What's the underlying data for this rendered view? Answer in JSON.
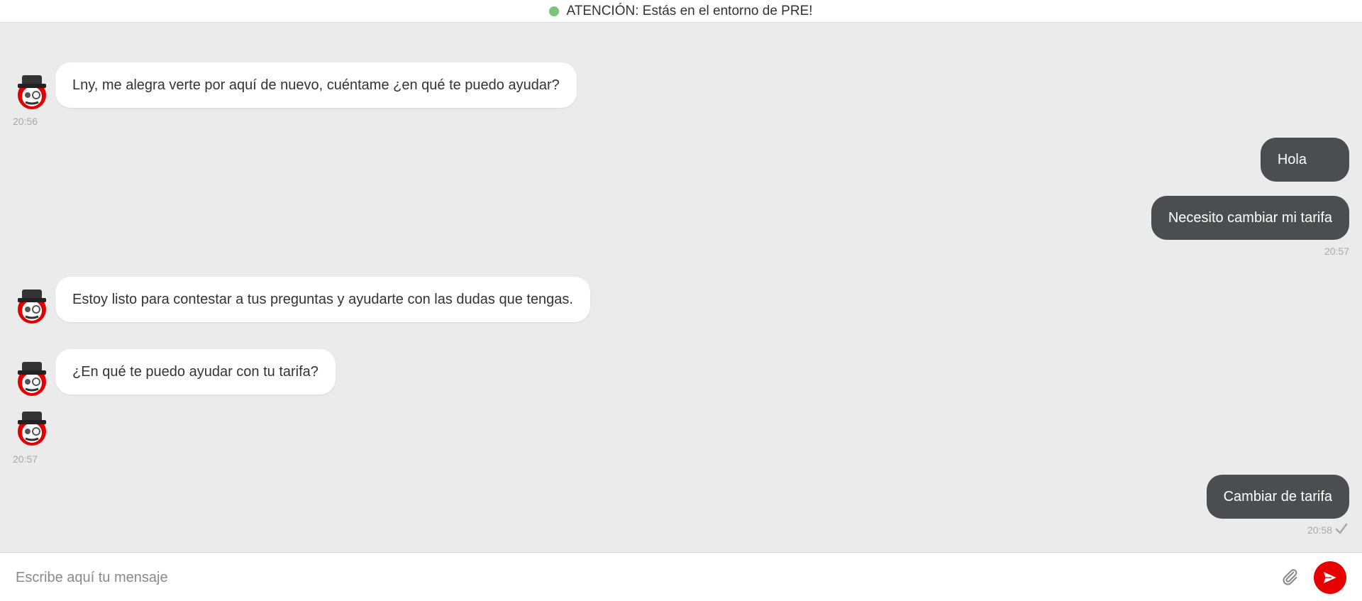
{
  "banner": {
    "text": "ATENCIÓN: Estás en el entorno de PRE!",
    "dot_color": "#7cc47c"
  },
  "chat": {
    "bot_avatar_icon": "robot-mascot-icon",
    "messages": [
      {
        "from": "bot",
        "text": "Lny,  me alegra verte por aquí de nuevo, cuéntame ¿en qué te puedo ayudar?"
      },
      {
        "from": "bot_time",
        "text": "20:56"
      },
      {
        "from": "user",
        "text": "Hola"
      },
      {
        "from": "user",
        "text": "Necesito cambiar mi tarifa"
      },
      {
        "from": "user_time",
        "text": "20:57"
      },
      {
        "from": "bot",
        "text": "Estoy listo para contestar a tus preguntas y ayudarte con las dudas que tengas."
      },
      {
        "from": "bot",
        "text": "¿En qué te puedo ayudar con tu tarifa?"
      },
      {
        "from": "bot_time",
        "text": "20:57"
      },
      {
        "from": "user",
        "text": "Cambiar de tarifa"
      },
      {
        "from": "user_time",
        "text": "20:58"
      }
    ]
  },
  "composer": {
    "placeholder": "Escribe aquí tu mensaje",
    "attach_icon": "paperclip-icon",
    "send_icon": "send-icon"
  },
  "colors": {
    "background": "#ebebeb",
    "user_bubble": "#4b4e4f",
    "bot_bubble": "#ffffff",
    "send_button": "#e60000"
  }
}
